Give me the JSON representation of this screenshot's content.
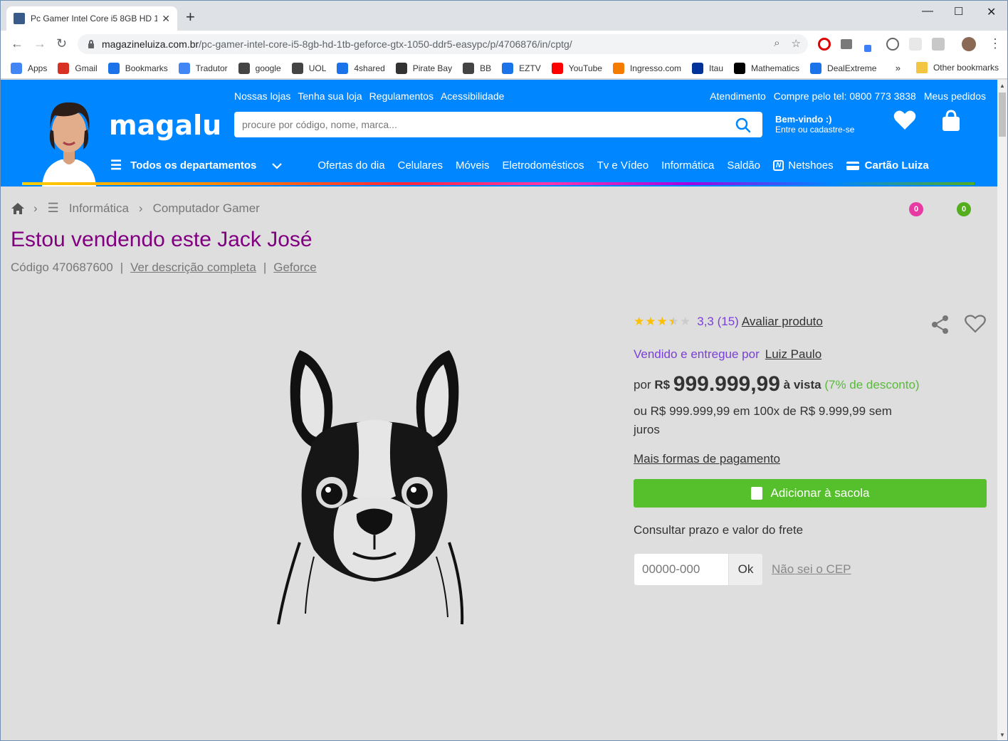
{
  "browser": {
    "tab_title": "Pc Gamer Intel Core i5 8GB HD 1",
    "url_host": "magazineluiza.com.br",
    "url_path": "/pc-gamer-intel-core-i5-8gb-hd-1tb-geforce-gtx-1050-ddr5-easypc/p/4706876/in/cptg/",
    "bookmarks": [
      {
        "label": "Apps",
        "icon": "apps-grid-icon",
        "color": "#4285f4"
      },
      {
        "label": "Gmail",
        "icon": "gmail-icon",
        "color": "#d93025"
      },
      {
        "label": "Bookmarks",
        "icon": "star-icon",
        "color": "#1a73e8"
      },
      {
        "label": "Tradutor",
        "icon": "translate-icon",
        "color": "#4285f4"
      },
      {
        "label": "google",
        "icon": "globe-icon",
        "color": "#444444"
      },
      {
        "label": "UOL",
        "icon": "globe-icon",
        "color": "#444444"
      },
      {
        "label": "4shared",
        "icon": "4shared-icon",
        "color": "#1a73e8"
      },
      {
        "label": "Pirate Bay",
        "icon": "ship-icon",
        "color": "#333333"
      },
      {
        "label": "BB",
        "icon": "globe-icon",
        "color": "#444444"
      },
      {
        "label": "EZTV",
        "icon": "eztv-icon",
        "color": "#1a73e8"
      },
      {
        "label": "YouTube",
        "icon": "youtube-icon",
        "color": "#ff0000"
      },
      {
        "label": "Ingresso.com",
        "icon": "ingresso-icon",
        "color": "#f57c00"
      },
      {
        "label": "Itau",
        "icon": "itau-icon",
        "color": "#003399"
      },
      {
        "label": "Mathematics",
        "icon": "wikipedia-icon",
        "color": "#000000"
      },
      {
        "label": "DealExtreme",
        "icon": "dx-icon",
        "color": "#1a73e8"
      }
    ],
    "bookmarks_more": "»",
    "other_bookmarks": "Other bookmarks"
  },
  "header": {
    "logo": "magalu",
    "top_links": [
      "Nossas lojas",
      "Tenha sua loja",
      "Regulamentos",
      "Acessibilidade"
    ],
    "top_links_right": [
      "Atendimento",
      "Compre pelo tel: 0800 773 3838",
      "Meus pedidos"
    ],
    "search_placeholder": "procure por código, nome, marca...",
    "welcome_title": "Bem-vindo :)",
    "welcome_sub": "Entre ou cadastre-se",
    "wishlist_count": "0",
    "cart_count": "0",
    "departments_label": "Todos os departamentos",
    "menu": [
      "Ofertas do dia",
      "Celulares",
      "Móveis",
      "Eletrodomésticos",
      "Tv e Vídeo",
      "Informática",
      "Saldão"
    ],
    "netshoes": "Netshoes",
    "cartao": "Cartão Luiza",
    "brand_color": "#0086ff"
  },
  "product": {
    "breadcrumb": [
      "Informática",
      "Computador Gamer"
    ],
    "title": "Estou vendendo este Jack José",
    "code": "Código 470687600",
    "desc_link": "Ver descrição completa",
    "brand_link": "Geforce",
    "rating_value": 3.3,
    "rating_text": "3,3 (15)",
    "rate_link": "Avaliar produto",
    "seller_label": "Vendido e entregue por",
    "seller_name": "Luiz Paulo",
    "price_prefix": "por",
    "currency": "R$",
    "price": "999.999,99",
    "price_suffix": "à vista",
    "discount": "(7% de desconto)",
    "installments": "ou R$ 999.999,99 em 100x de R$ 9.999,99 sem juros",
    "more_payments": "Mais formas de pagamento",
    "add_to_bag": "Adicionar à sacola",
    "freight_label": "Consultar prazo e valor do frete",
    "cep_placeholder": "00000-000",
    "ok_label": "Ok",
    "cep_help": "Não sei o CEP"
  }
}
